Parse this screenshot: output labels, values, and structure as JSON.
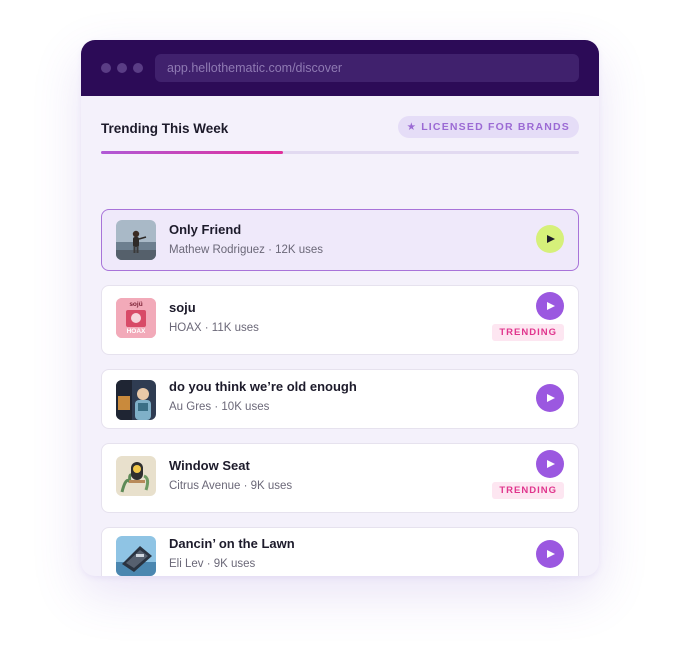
{
  "browser": {
    "url": "app.hellothematic.com/discover"
  },
  "section": {
    "title": "Trending This Week",
    "badge_label": "LICENSED FOR BRANDS",
    "badge_icon": "star-icon",
    "progress": 0.38
  },
  "colors": {
    "titlebar": "#2c0b57",
    "accent_purple": "#9b58e0",
    "active_play": "#d6f07a",
    "trending_text": "#e0358d",
    "trending_bg": "#fde6f1"
  },
  "tracks": [
    {
      "title": "Only Friend",
      "meta": "Mathew Rodriguez · 12K uses",
      "active": true,
      "trending": ""
    },
    {
      "title": "soju",
      "meta": "HOAX · 11K uses",
      "active": false,
      "trending": "TRENDING",
      "art_text_top": "sojü",
      "art_text_bottom": "HOAX"
    },
    {
      "title": "do you think we’re old enough",
      "meta": "Au Gres · 10K uses",
      "active": false,
      "trending": ""
    },
    {
      "title": "Window Seat",
      "meta": "Citrus Avenue · 9K uses",
      "active": false,
      "trending": "TRENDING"
    },
    {
      "title": "Dancin’ on the Lawn",
      "meta": "Eli Lev · 9K uses",
      "active": false,
      "trending": ""
    }
  ]
}
